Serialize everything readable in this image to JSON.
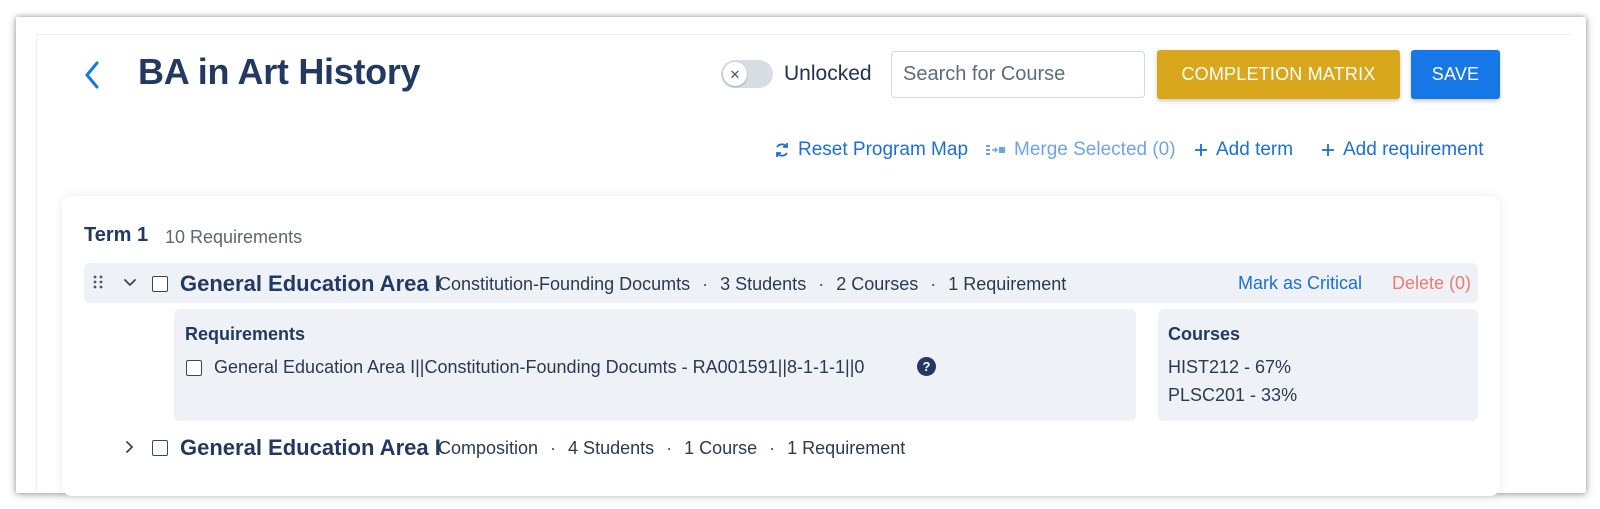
{
  "header": {
    "title": "BA in Art History",
    "lock_toggle": {
      "state": "unlocked",
      "knob_glyph": "✕",
      "label": "Unlocked"
    },
    "search": {
      "placeholder": "Search for Course",
      "value": ""
    },
    "completion_matrix_label": "COMPLETION MATRIX",
    "save_label": "SAVE"
  },
  "actions": {
    "reset": "Reset Program Map",
    "merge": "Merge Selected (0)",
    "add_term": "Add term",
    "add_requirement": "Add requirement"
  },
  "term": {
    "title": "Term 1",
    "count": "10 Requirements",
    "groups": [
      {
        "name": "General Education Area I",
        "subtitle": "Constitution-Founding Documts",
        "separator": "·",
        "students": "3 Students",
        "courses": "2 Courses",
        "requirements": "1 Requirement",
        "expanded": true,
        "mark_critical": "Mark as Critical",
        "delete": "Delete (0)",
        "requirements_panel": {
          "title": "Requirements",
          "items": [
            "General Education Area I||Constitution-Founding Documts - RA001591||8-1-1-1||0"
          ],
          "help_glyph": "?"
        },
        "courses_panel": {
          "title": "Courses",
          "items": [
            "HIST212 - 67%",
            "PLSC201 - 33%"
          ]
        }
      },
      {
        "name": "General Education Area I",
        "subtitle": "Composition",
        "separator": "·",
        "students": "4 Students",
        "courses": "1 Course",
        "requirements": "1 Requirement",
        "expanded": false
      }
    ]
  },
  "colors": {
    "primary_blue": "#1677e6",
    "link_blue": "#1a6fd8",
    "matrix_gold": "#d9a71c",
    "delete_red": "#f07b6e",
    "title_navy": "#223a63",
    "panel_bg": "#eef1f6"
  },
  "icons": {
    "back": "chevron-left-icon",
    "reset": "refresh-icon",
    "merge": "merge-icon",
    "add": "plus-icon",
    "drag": "drag-handle-icon",
    "expand": "chevron-down-icon",
    "collapse": "chevron-right-icon",
    "help": "help-circle-icon"
  }
}
